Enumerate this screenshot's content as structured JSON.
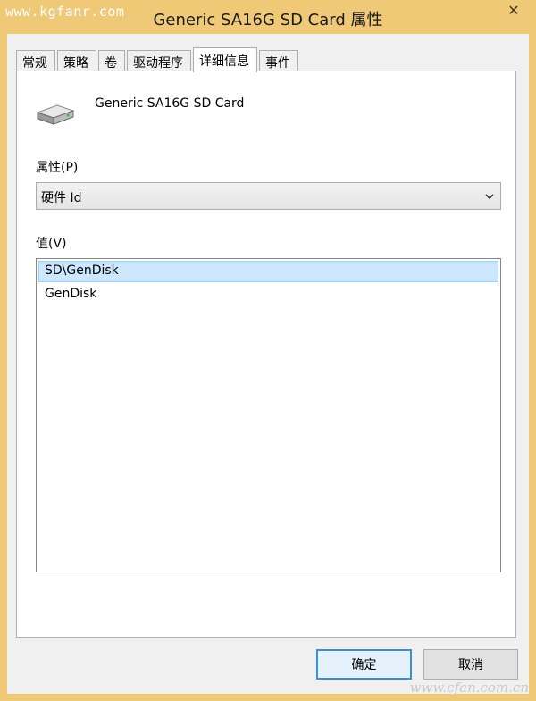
{
  "watermark_top": "www.kgfanr.com",
  "window": {
    "title": "Generic SA16G SD Card 属性",
    "close_glyph": "✕"
  },
  "tabs": [
    {
      "label": "常规"
    },
    {
      "label": "策略"
    },
    {
      "label": "卷"
    },
    {
      "label": "驱动程序"
    },
    {
      "label": "详细信息"
    },
    {
      "label": "事件"
    }
  ],
  "active_tab": "详细信息",
  "device": {
    "name": "Generic SA16G SD Card",
    "icon": "drive-icon"
  },
  "property": {
    "label": "属性(P)",
    "selected": "硬件 Id"
  },
  "values": {
    "label": "值(V)",
    "items": [
      {
        "text": "SD\\GenDisk",
        "selected": true
      },
      {
        "text": "GenDisk",
        "selected": false
      }
    ]
  },
  "buttons": {
    "ok": "确定",
    "cancel": "取消"
  },
  "watermark_bottom": "www.cfan.com.cn",
  "colors": {
    "title_bar": "#f0c977",
    "selection": "#cce8ff",
    "ok_border": "#3c8fdc"
  }
}
